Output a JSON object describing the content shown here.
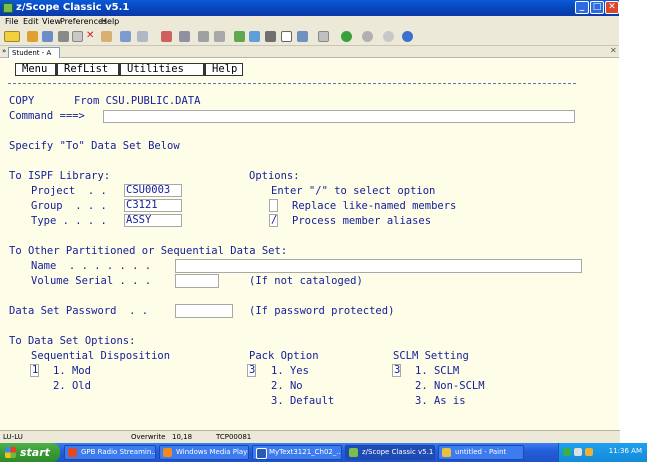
{
  "window": {
    "title": "z/Scope Classic v5.1"
  },
  "menubar": [
    "File",
    "Edit",
    "View",
    "Preferences",
    "Help"
  ],
  "session_tab": "Student - A",
  "ispf": {
    "pulldown": [
      "Menu",
      "RefList",
      "Utilities",
      "Help"
    ],
    "panel_id": "COPY",
    "header": "From CSU.PUBLIC.DATA",
    "command_label": "Command ===>",
    "command_value": "",
    "instruction": "Specify \"To\" Data Set Below",
    "to_library": {
      "heading": "To ISPF Library:",
      "project_label": "Project  . .",
      "project_value": "CSU0003",
      "group_label": "Group  . . .",
      "group_value": "C3121",
      "type_label": "Type . . . .",
      "type_value": "ASSY"
    },
    "options": {
      "heading": "Options:",
      "hint": "Enter \"/\" to select option",
      "replace_check": "",
      "replace_label": "Replace like-named members",
      "aliases_check": "/",
      "aliases_label": "Process member aliases"
    },
    "other_ds": {
      "heading": "To Other Partitioned or Sequential Data Set:",
      "name_label": "Name  . . . . . . .",
      "name_value": "",
      "volume_label": "Volume Serial . . .",
      "volume_value": "",
      "volume_note": "(If not cataloged)"
    },
    "password": {
      "label": "Data Set Password  . .",
      "value": "",
      "note": "(If password protected)"
    },
    "ds_options": {
      "heading": "To Data Set Options:",
      "seq_heading": "Sequential Disposition",
      "seq_value": "1",
      "seq_opts": [
        "1. Mod",
        "2. Old"
      ],
      "pack_heading": "Pack Option",
      "pack_value": "3",
      "pack_opts": [
        "1. Yes",
        "2. No",
        "3. Default"
      ],
      "sclm_heading": "SCLM Setting",
      "sclm_value": "3",
      "sclm_opts": [
        "1. SCLM",
        "2. Non-SCLM",
        "3. As is"
      ]
    }
  },
  "statusbar": {
    "lu": "LU-LU",
    "mode": "Overwrite",
    "cursor": "10,18",
    "conn": "TCP00081"
  },
  "taskbar": {
    "start": "start",
    "tasks": [
      "GPB Radio Streamin...",
      "Windows Media Player",
      "MyText3121_Ch02_...",
      "z/Scope Classic v5.1",
      "untitled - Paint"
    ],
    "clock": "11:36 AM"
  }
}
